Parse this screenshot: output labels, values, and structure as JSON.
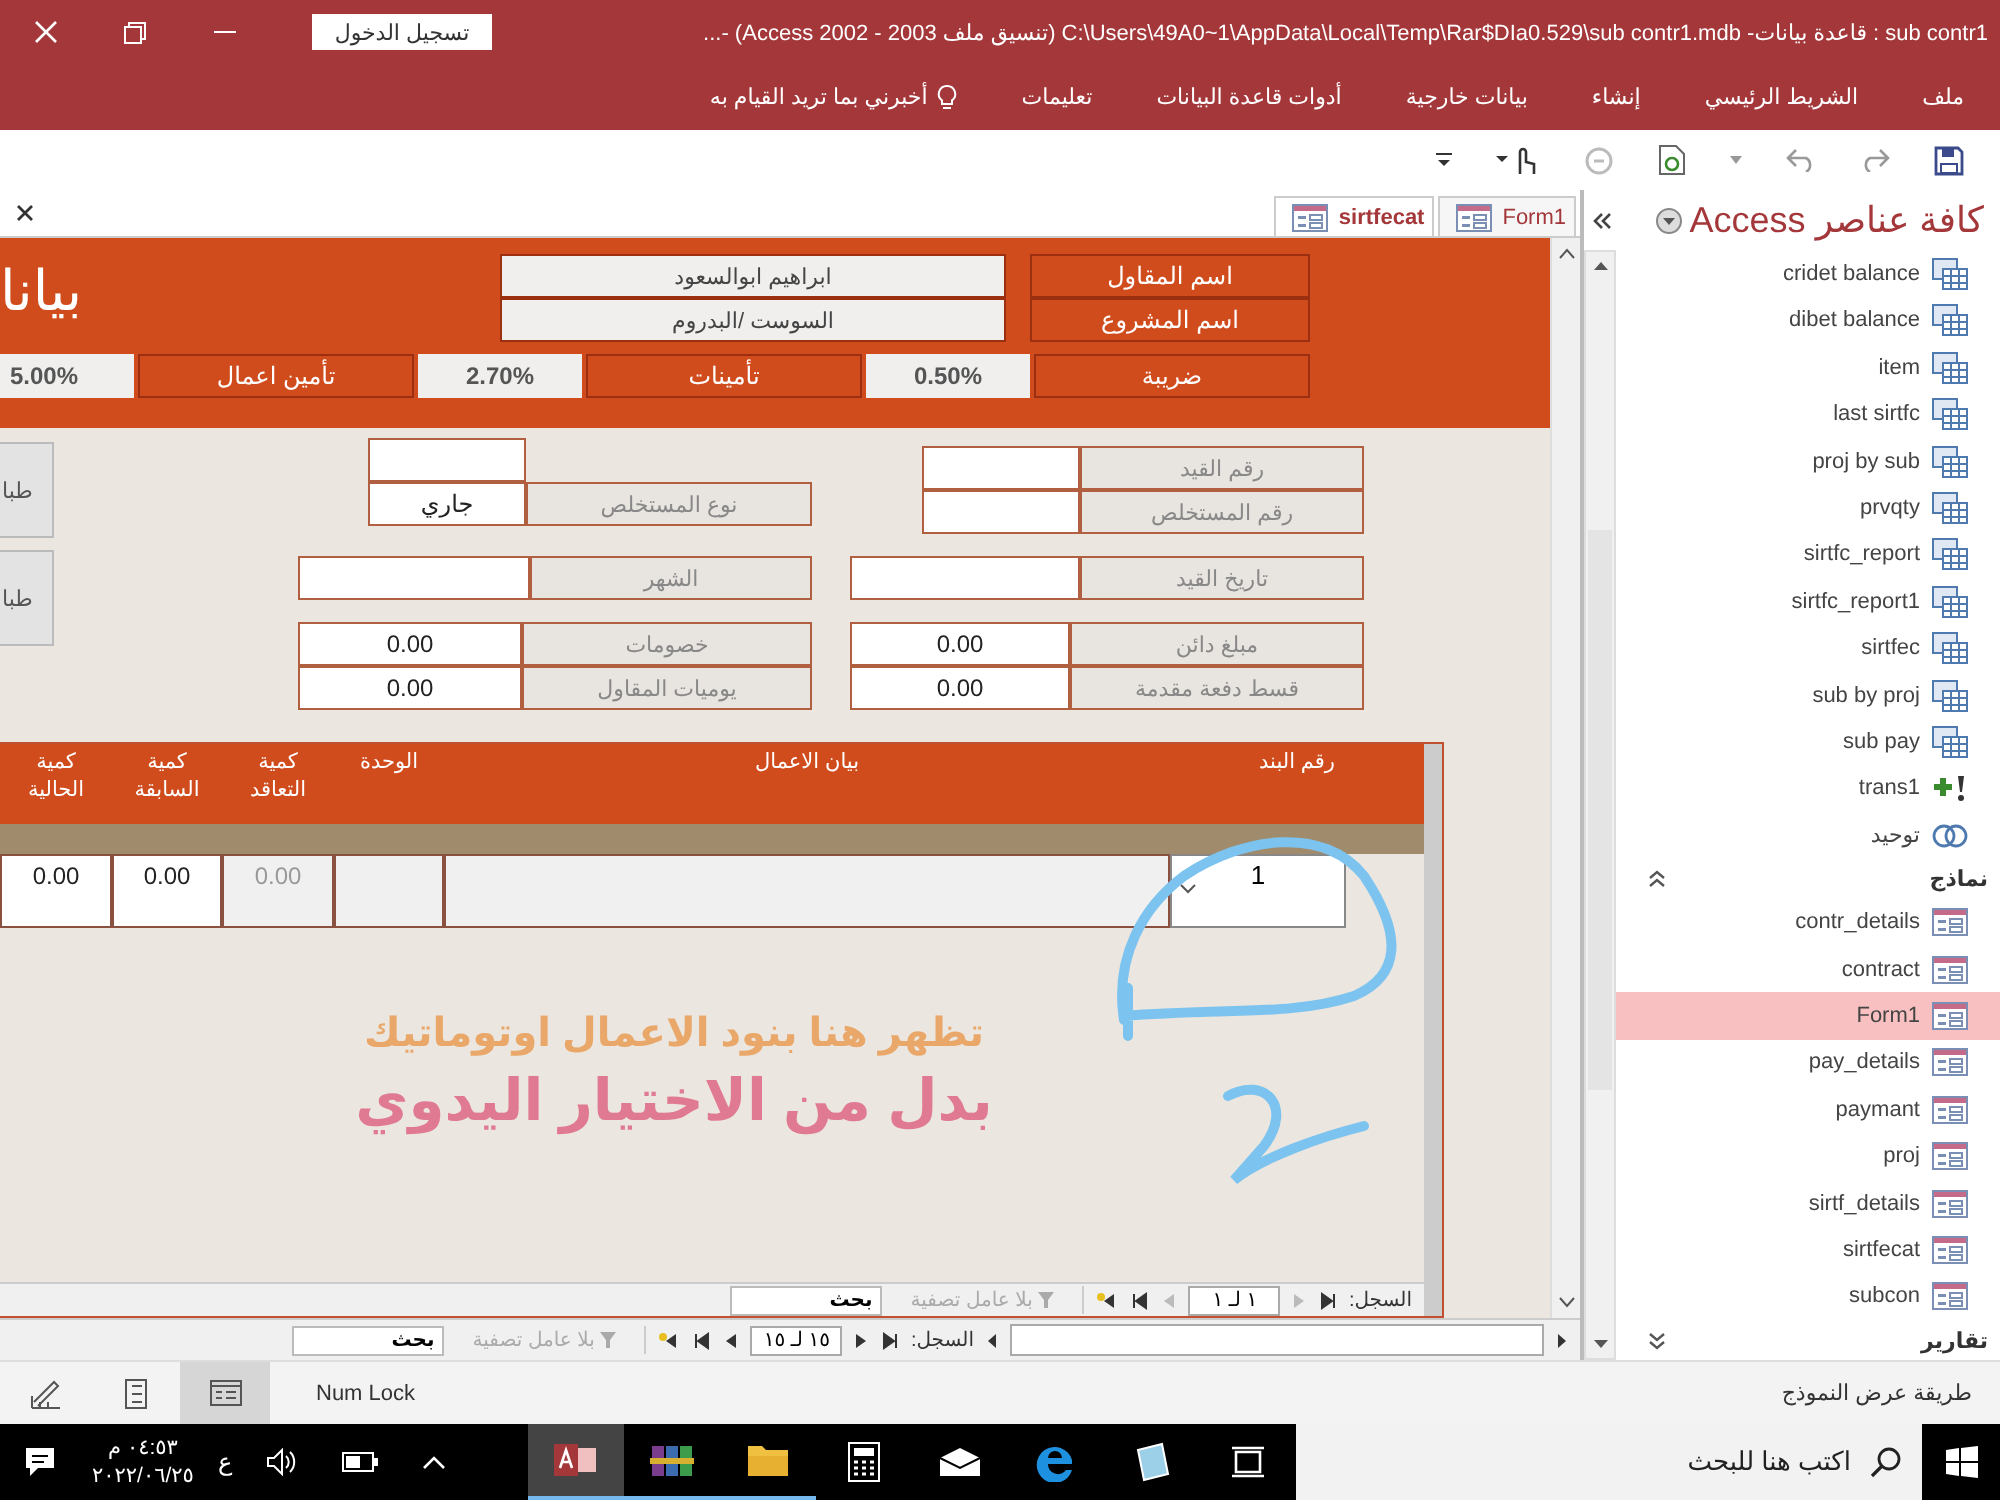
{
  "title_bar": {
    "title": "sub contr1 : قاعدة بيانات- C:\\Users\\49A0~1\\AppData\\Local\\Temp\\Rar$DIa0.529\\sub contr1.mdb (تنسيق ملف Access 2002 - 2003) -...",
    "sign_in": "تسجيل الدخول"
  },
  "ribbon_tabs": [
    "ملف",
    "الشريط الرئيسي",
    "إنشاء",
    "بيانات خارجية",
    "أدوات قاعدة البيانات",
    "تعليمات"
  ],
  "tell_me": "أخبرني بما تريد القيام به",
  "document_tabs": [
    {
      "label": "Form1",
      "selected": false
    },
    {
      "label": "sirtfecat",
      "selected": true
    }
  ],
  "form": {
    "title": "بيانا",
    "header_fields": [
      {
        "label": "اسم المقاول",
        "value": "ابراهيم ابوالسعود"
      },
      {
        "label": "اسم المشروع",
        "value": "السوست /البدروم"
      }
    ],
    "rates": [
      {
        "label": "ضريبة",
        "value": "0.50%"
      },
      {
        "label": "تأمينات",
        "value": "2.70%"
      },
      {
        "label": "تأمين اعمال",
        "value": "5.00%"
      }
    ],
    "side_buttons": [
      "طبا",
      "طبا"
    ],
    "fields": [
      {
        "label": "رقم القيد"
      },
      {
        "label": "رقم المستخلص"
      },
      {
        "label": "نوع المستخلص",
        "value": "جاري"
      },
      {
        "label": "تاريخ القيد"
      },
      {
        "label": "الشهر"
      },
      {
        "label": "مبلغ دائن",
        "value": "0.00"
      },
      {
        "label": "قسط دفعة مقدمة",
        "value": "0.00"
      },
      {
        "label": "خصومات",
        "value": "0.00"
      },
      {
        "label": "يوميات المقاول",
        "value": "0.00"
      }
    ],
    "subform": {
      "columns": [
        "رقم البند",
        "بيان الاعمال",
        "الوحدة",
        "كمية التعاقد",
        "كمية السابقة",
        "كمية الحالية"
      ],
      "rows": [
        {
          "cells": [
            {
              "kind": "combo",
              "value": "1"
            },
            {
              "kind": "text"
            },
            {
              "kind": "text"
            },
            {
              "kind": "number",
              "value": "0.00",
              "disabled": true
            },
            {
              "kind": "number",
              "value": "0.00",
              "disabled": false
            },
            {
              "kind": "number",
              "value": "0.00",
              "disabled": false
            }
          ]
        }
      ],
      "annotation": [
        "تظهر هنا بنود الاعمال اوتوماتيك",
        "بدل من الاختيار اليدوي"
      ],
      "navigation": {
        "label": "السجل:",
        "record": "١ لـ ١",
        "filter": "بلا عامل تصفية",
        "search": "بحث"
      }
    },
    "navigation": {
      "label": "السجل:",
      "record": "١٥ لـ ١٥",
      "filter": "بلا عامل تصفية",
      "search": "بحث"
    }
  },
  "nav_pane": {
    "title": "كافة عناصر Access",
    "items": [
      {
        "label": "cridet balance",
        "kind": "query",
        "selected": false
      },
      {
        "label": "dibet balance",
        "kind": "query",
        "selected": false
      },
      {
        "label": "item",
        "kind": "query",
        "selected": false
      },
      {
        "label": "last sirtfc",
        "kind": "query",
        "selected": false
      },
      {
        "label": "proj by sub",
        "kind": "query",
        "selected": false
      },
      {
        "label": "prvqty",
        "kind": "query",
        "selected": false
      },
      {
        "label": "sirtfc_report",
        "kind": "query",
        "selected": false
      },
      {
        "label": "sirtfc_report1",
        "kind": "query",
        "selected": false
      },
      {
        "label": "sirtfec",
        "kind": "query",
        "selected": false
      },
      {
        "label": "sub by proj",
        "kind": "query",
        "selected": false
      },
      {
        "label": "sub pay",
        "kind": "query",
        "selected": false
      },
      {
        "label": "trans1",
        "kind": "action",
        "selected": false
      },
      {
        "label": "توحيد",
        "kind": "union",
        "selected": false
      }
    ],
    "groups": [
      {
        "label": "نماذج",
        "expanded": true,
        "items": [
          {
            "label": "contr_details",
            "kind": "form",
            "selected": false
          },
          {
            "label": "contract",
            "kind": "form",
            "selected": false
          },
          {
            "label": "Form1",
            "kind": "form",
            "selected": true
          },
          {
            "label": "pay_details",
            "kind": "form",
            "selected": false
          },
          {
            "label": "paymant",
            "kind": "form",
            "selected": false
          },
          {
            "label": "proj",
            "kind": "form",
            "selected": false
          },
          {
            "label": "sirtf_details",
            "kind": "form",
            "selected": false
          },
          {
            "label": "sirtfecat",
            "kind": "form",
            "selected": false
          },
          {
            "label": "subcon",
            "kind": "form",
            "selected": false
          }
        ]
      },
      {
        "label": "تقارير",
        "expanded": false
      }
    ]
  },
  "status_bar": {
    "view": "طريقة عرض النموذج",
    "num_lock": "Num Lock",
    "view_buttons": [
      {
        "kind": "design",
        "selected": false
      },
      {
        "kind": "layout",
        "selected": false
      },
      {
        "kind": "form",
        "selected": true
      }
    ]
  },
  "taskbar": {
    "search_placeholder": "اكتب هنا للبحث",
    "language": "ع",
    "time": "٠٤:٥٣ م",
    "date": "٢٠٢٢/٠٦/٢٥",
    "apps": [
      {
        "kind": "access",
        "running": true,
        "selected": true
      },
      {
        "kind": "archiver",
        "running": true,
        "selected": false
      },
      {
        "kind": "explorer",
        "running": true,
        "selected": false
      },
      {
        "kind": "calculator",
        "running": false,
        "selected": false
      },
      {
        "kind": "mail",
        "running": false,
        "selected": false
      },
      {
        "kind": "browser",
        "running": false,
        "selected": false
      },
      {
        "kind": "notes",
        "running": false,
        "selected": false
      },
      {
        "kind": "taskview",
        "running": false,
        "selected": false
      }
    ]
  }
}
